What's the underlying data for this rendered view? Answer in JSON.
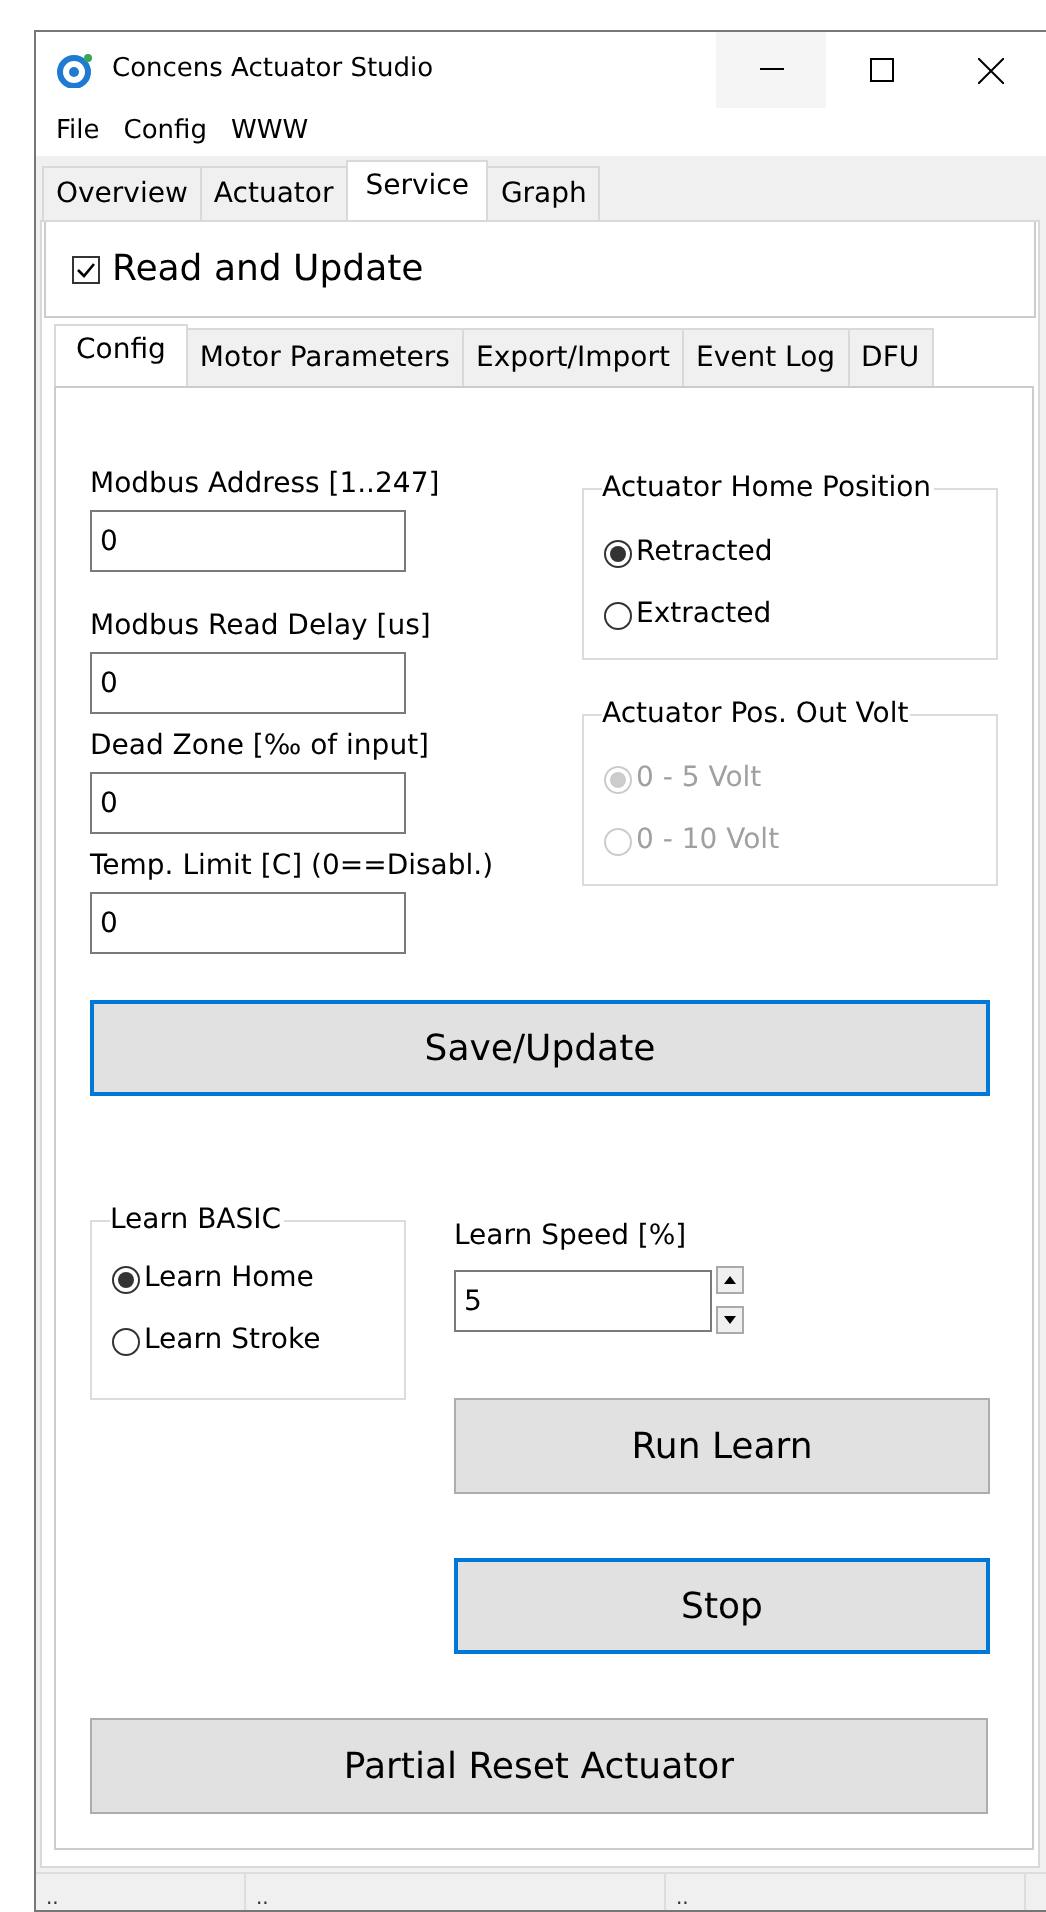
{
  "window": {
    "title": "Concens Actuator Studio"
  },
  "menu": [
    "File",
    "Config",
    "WWW"
  ],
  "tabs": [
    {
      "label": "Overview",
      "selected": false
    },
    {
      "label": "Actuator",
      "selected": false
    },
    {
      "label": "Service",
      "selected": true
    },
    {
      "label": "Graph",
      "selected": false
    }
  ],
  "read_and_update": {
    "label": "Read and Update",
    "checked": true
  },
  "subtabs": [
    {
      "label": "Config",
      "selected": true
    },
    {
      "label": "Motor Parameters",
      "selected": false
    },
    {
      "label": "Export/Import",
      "selected": false
    },
    {
      "label": "Event Log",
      "selected": false
    },
    {
      "label": "DFU",
      "selected": false
    }
  ],
  "fields": [
    {
      "label": "Modbus Address [1..247]",
      "value": "0"
    },
    {
      "label": "Modbus Read Delay [us]",
      "value": "0"
    },
    {
      "label": "Dead Zone [‰ of input]",
      "value": "0"
    },
    {
      "label": "Temp. Limit [C] (0==Disabl.)",
      "value": "0"
    }
  ],
  "groups": [
    {
      "title": "Actuator Home Position",
      "options": [
        {
          "label": "Retracted",
          "selected": true,
          "disabled": false
        },
        {
          "label": "Extracted",
          "selected": false,
          "disabled": false
        }
      ]
    },
    {
      "title": "Actuator Pos. Out Volt",
      "options": [
        {
          "label": "0 - 5 Volt",
          "selected": true,
          "disabled": true
        },
        {
          "label": "0 - 10 Volt",
          "selected": false,
          "disabled": true
        }
      ]
    }
  ],
  "save_button": {
    "label": "Save/Update",
    "focused": true
  },
  "learn_group": {
    "title": "Learn BASIC",
    "options": [
      {
        "label": "Learn Home",
        "selected": true,
        "disabled": false
      },
      {
        "label": "Learn Stroke",
        "selected": false,
        "disabled": false
      }
    ]
  },
  "learn_speed": {
    "label": "Learn Speed [%]",
    "value": "5"
  },
  "run_learn_button": {
    "label": "Run Learn",
    "focused": false
  },
  "stop_button": {
    "label": "Stop",
    "focused": true
  },
  "reset_button": {
    "label": "Partial Reset Actuator",
    "focused": false
  },
  "status_bar": [
    "..",
    "..",
    ".."
  ]
}
